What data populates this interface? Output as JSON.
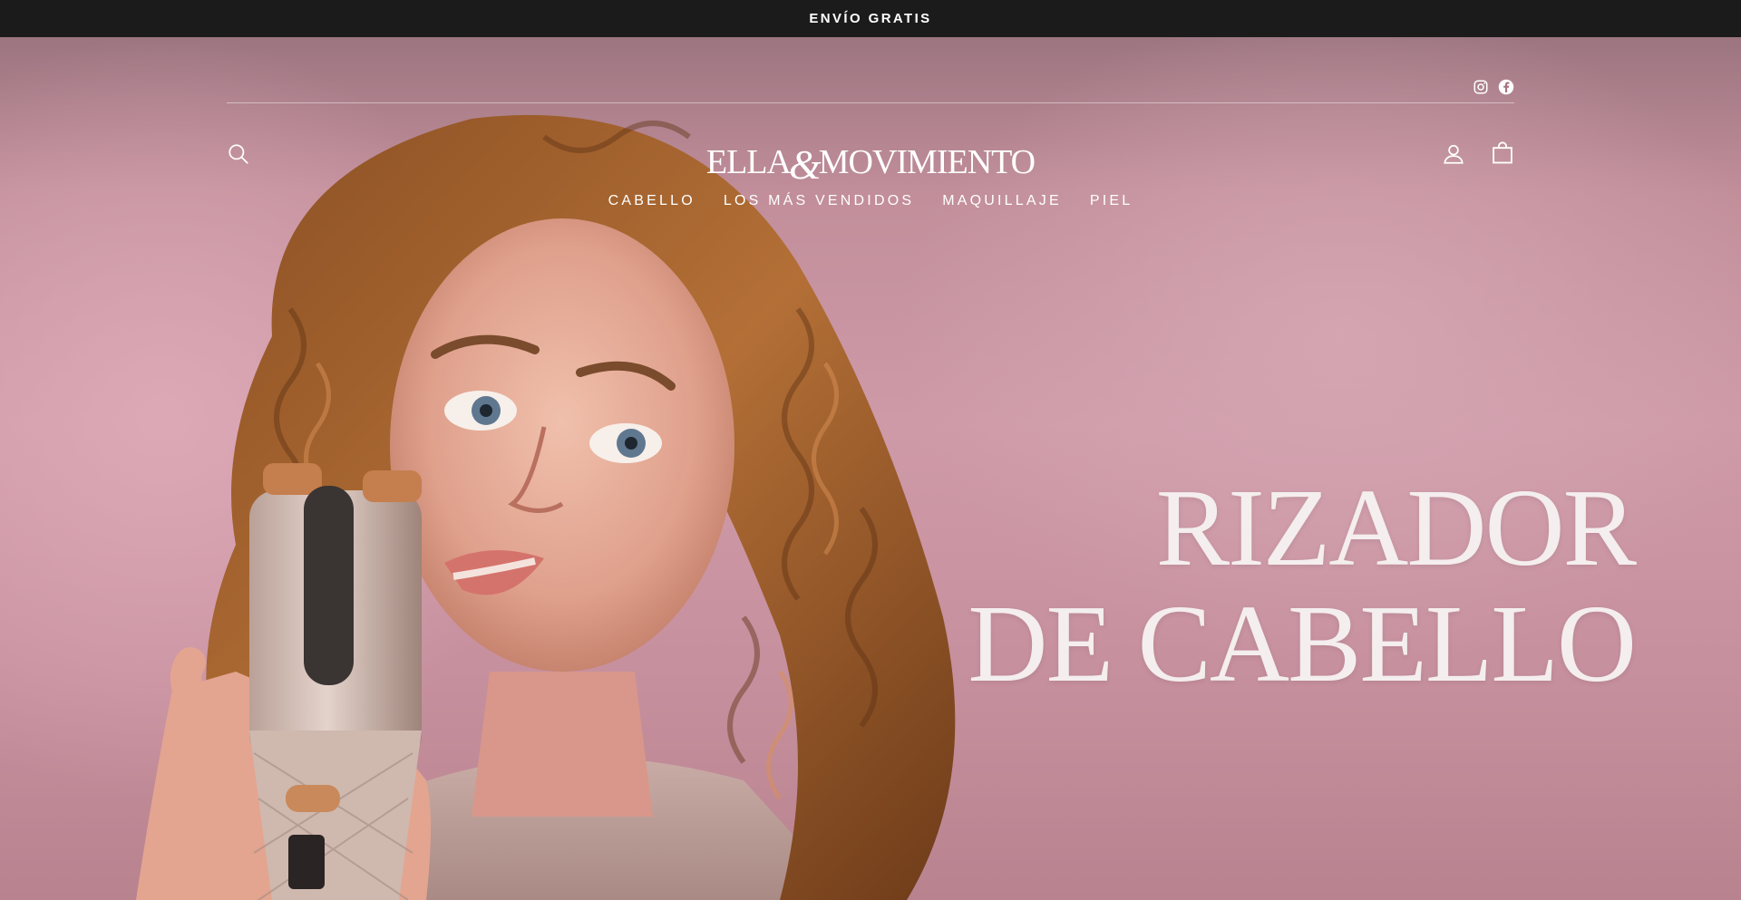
{
  "announcement": {
    "text": "ENVÍO GRATIS"
  },
  "social": {
    "instagram_icon": "instagram-icon",
    "facebook_icon": "facebook-icon"
  },
  "header": {
    "search_icon": "search-icon",
    "account_icon": "user-icon",
    "cart_icon": "bag-icon",
    "logo": {
      "part1": "ELLA",
      "amp": "&",
      "part2": "MOVIMIENTO"
    }
  },
  "nav": {
    "items": [
      {
        "label": "CABELLO"
      },
      {
        "label": "LOS MÁS VENDIDOS"
      },
      {
        "label": "MAQUILLAJE"
      },
      {
        "label": "PIEL"
      }
    ]
  },
  "hero": {
    "line1": "RIZADOR",
    "line2": "DE CABELLO"
  }
}
